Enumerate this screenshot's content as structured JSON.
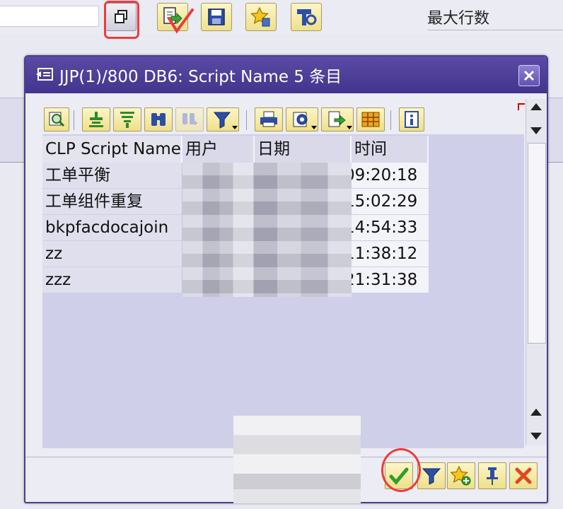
{
  "background": {
    "max_rows_label": "最大行数",
    "toolbar_icons": [
      "multiple-selection-icon",
      "import-icon",
      "save-icon",
      "favorite-delete-icon",
      "tools-icon"
    ]
  },
  "dialog": {
    "title": "JJP(1)/800 DB6: Script Name 5 条目",
    "alv_toolbar_icons": [
      "details-icon",
      "sort-ascending-icon",
      "sort-descending-icon",
      "find-icon",
      "find-next-icon",
      "filter-icon",
      "print-icon",
      "view-icon",
      "export-icon",
      "layout-icon",
      "info-icon"
    ],
    "columns": [
      "CLP Script Name",
      "用户",
      "日期",
      "时间"
    ],
    "rows": [
      {
        "name": "工单平衡",
        "time": "09:20:18"
      },
      {
        "name": "工单组件重复",
        "time": "15:02:29"
      },
      {
        "name": "bkpfacdocajoin",
        "time": "14:54:33"
      },
      {
        "name": "zz",
        "time": "11:38:12"
      },
      {
        "name": "zzz",
        "time": "21:31:38"
      }
    ],
    "footer_icons": [
      "confirm-icon",
      "filter-icon",
      "add-favorite-icon",
      "pin-icon",
      "cancel-icon"
    ]
  },
  "colors": {
    "title_bar": "#4c3e8e",
    "button_yellow": "#f6eca8",
    "annotation_red": "#ee3b3b"
  }
}
